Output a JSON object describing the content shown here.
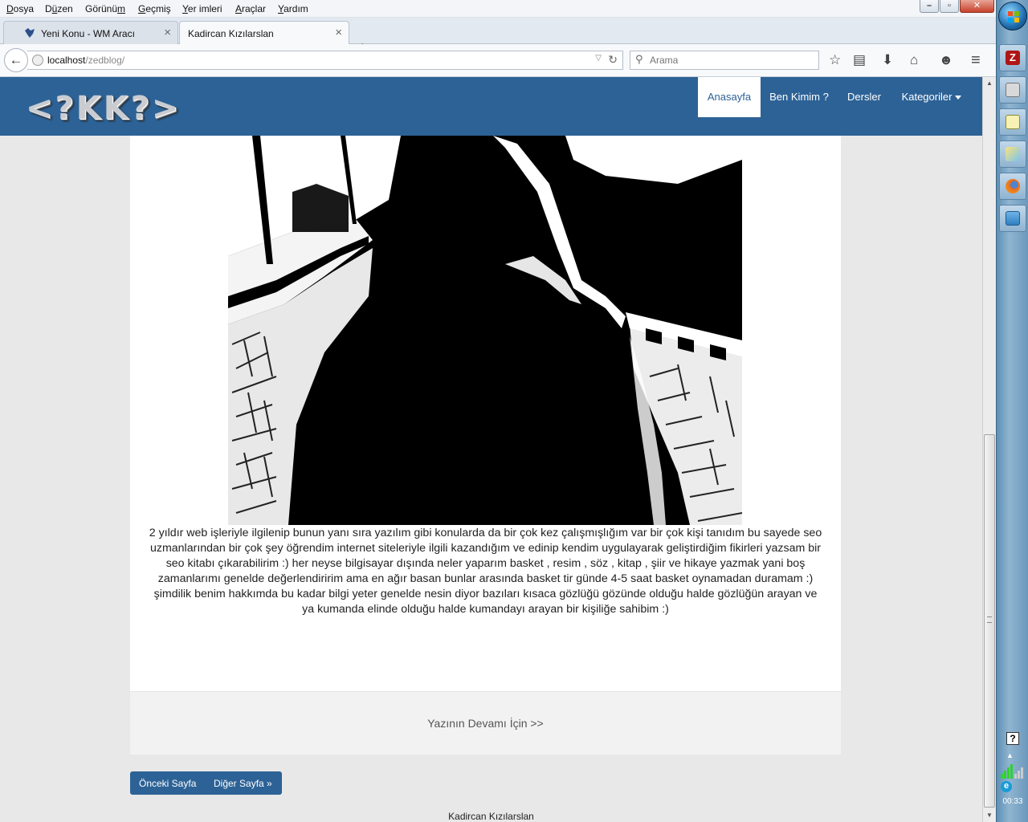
{
  "menu": {
    "items": [
      {
        "pre": "",
        "key": "D",
        "post": "osya"
      },
      {
        "pre": "D",
        "key": "ü",
        "post": "zen"
      },
      {
        "pre": "Görünü",
        "key": "m",
        "post": ""
      },
      {
        "pre": "",
        "key": "G",
        "post": "eçmiş"
      },
      {
        "pre": "",
        "key": "Y",
        "post": "er imleri"
      },
      {
        "pre": "",
        "key": "A",
        "post": "raçlar"
      },
      {
        "pre": "",
        "key": "Y",
        "post": "ardım"
      }
    ]
  },
  "window_controls": {
    "minimize": "–",
    "restore": "▫",
    "close": "✕"
  },
  "tabs": [
    {
      "title": "Yeni Konu - WM Aracı",
      "active": false
    },
    {
      "title": "Kadircan Kızılarslan",
      "active": true
    }
  ],
  "tab_close": "×",
  "new_tab": "+",
  "navbar": {
    "back": "←",
    "url_host": "localhost",
    "url_path": "/zedblog/",
    "dropdown": "▽",
    "reload": "↻",
    "search_placeholder": "Arama",
    "search_glyph": "⚲",
    "toolbar_icons": [
      {
        "name": "bookmark-star-icon",
        "glyph": "☆"
      },
      {
        "name": "reading-list-icon",
        "glyph": "▤"
      },
      {
        "name": "downloads-icon",
        "glyph": "⬇"
      },
      {
        "name": "home-icon",
        "glyph": "⌂"
      },
      {
        "name": "chat-icon",
        "glyph": "☻"
      },
      {
        "name": "hamburger-menu-icon",
        "glyph": "≡"
      }
    ]
  },
  "site": {
    "logo": "<?KK?>",
    "nav": [
      {
        "label": "Anasayfa",
        "active": true
      },
      {
        "label": "Ben Kimim ?",
        "active": false
      },
      {
        "label": "Dersler",
        "active": false
      },
      {
        "label": "Kategoriler",
        "active": false,
        "dropdown": true
      }
    ],
    "colors": {
      "primary": "#2d6296"
    }
  },
  "post": {
    "text": "2 yıldır web işleriyle ilgilenip bunun yanı sıra yazılım gibi konularda da bir çok kez çalışmışlığım var bir çok kişi tanıdım bu sayede seo uzmanlarından bir çok şey öğrendim internet siteleriyle ilgili kazandığım ve edinip kendim uygulayarak geliştirdiğim fikirleri yazsam bir seo kitabı çıkarabilirim :) her neyse bilgisayar dışında neler yaparım basket , resim , söz , kitap , şiir ve hikaye yazmak yani boş zamanlarımı genelde değerlendiririm ama en ağır basan bunlar arasında basket tir günde 4-5 saat basket oynamadan duramam :) şimdilik benim hakkımda bu kadar bilgi yeter genelde nesin diyor bazıları kısaca gözlüğü gözünde olduğu halde gözlüğün arayan ve ya kumanda elinde olduğu halde kumandayı arayan bir kişiliğe sahibim :)",
    "read_more": "Yazının Devamı İçin >>"
  },
  "pager": {
    "prev": "Önceki Sayfa",
    "next": "Diğer Sayfa »"
  },
  "footer": {
    "text": "Kadircan Kızılarslan"
  },
  "scrollbar": {
    "up": "▲",
    "down": "▼"
  },
  "taskbar": {
    "apps": [
      "filezilla-icon",
      "printer-icon",
      "notepad-icon",
      "paint-icon",
      "firefox-icon",
      "network-icon"
    ],
    "help": "?",
    "tray_up": "▲",
    "tray_e": "e",
    "clock": "00:33"
  }
}
